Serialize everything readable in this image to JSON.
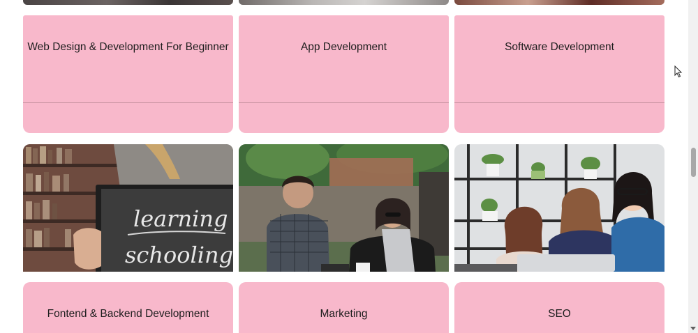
{
  "courses_top": [
    {
      "title": "Web Design & Development For Beginner"
    },
    {
      "title": "App Development"
    },
    {
      "title": "Software Development"
    }
  ],
  "photos": [
    {
      "alt": "learning-schooling chalkboard",
      "chalk_line1": "learning",
      "chalk_line2": "schooling"
    },
    {
      "alt": "people working at laptop outdoors"
    },
    {
      "alt": "women collaborating on laptop"
    }
  ],
  "courses_bottom": [
    {
      "title": "Fontend & Backend Development"
    },
    {
      "title": "Marketing"
    },
    {
      "title": "SEO"
    }
  ],
  "colors": {
    "card_pink": "#f8b8cb",
    "background": "#ffffff"
  }
}
